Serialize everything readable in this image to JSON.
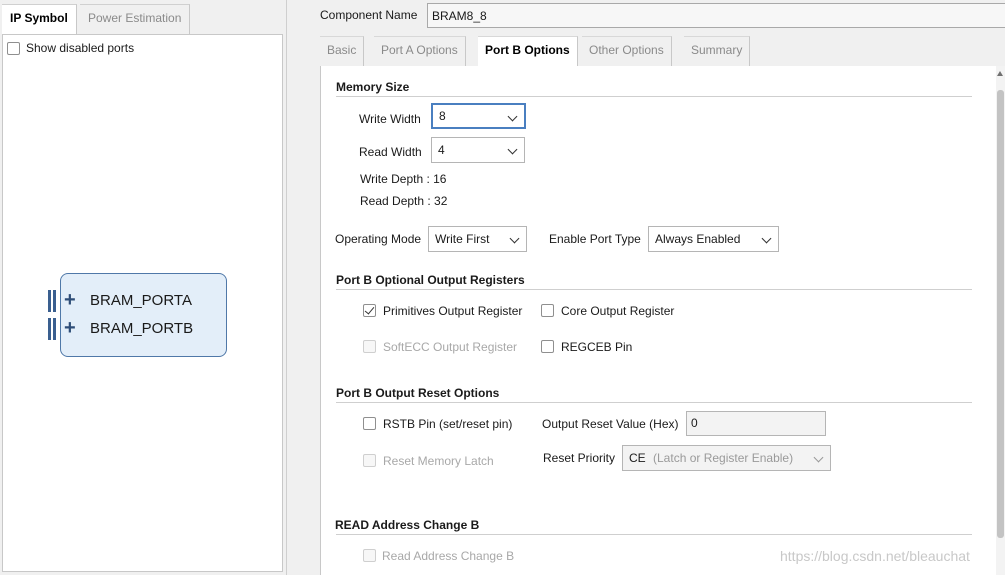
{
  "left_tabs": [
    "IP Symbol",
    "Power Estimation"
  ],
  "show_disabled_ports": "Show disabled ports",
  "ip_symbol": {
    "ports": [
      "BRAM_PORTA",
      "BRAM_PORTB"
    ]
  },
  "component_name": {
    "label": "Component Name",
    "value": "BRAM8_8"
  },
  "right_tabs": [
    "Basic",
    "Port A Options",
    "Port B Options",
    "Other Options",
    "Summary"
  ],
  "memory_size": {
    "title": "Memory Size",
    "write_width_label": "Write Width",
    "write_width_value": "8",
    "read_width_label": "Read Width",
    "read_width_value": "4",
    "write_depth": "Write Depth : 16",
    "read_depth": "Read Depth : 32"
  },
  "operating_mode": {
    "label": "Operating Mode",
    "value": "Write First"
  },
  "enable_port_type": {
    "label": "Enable Port Type",
    "value": "Always Enabled"
  },
  "optional_registers": {
    "title": "Port B Optional Output Registers",
    "primitives": "Primitives Output Register",
    "core": "Core Output Register",
    "softecc": "SoftECC Output Register",
    "regceb": "REGCEB Pin"
  },
  "reset_options": {
    "title": "Port B Output Reset Options",
    "rstb": "RSTB Pin (set/reset pin)",
    "reset_value_label": "Output Reset Value (Hex)",
    "reset_value": "0",
    "reset_memory_latch": "Reset Memory Latch",
    "reset_priority_label": "Reset Priority",
    "reset_priority_value": "CE",
    "reset_priority_hint": "(Latch or Register Enable)"
  },
  "read_address_change": {
    "title": "READ Address Change B",
    "checkbox": "Read Address Change B"
  },
  "watermark": "https://blog.csdn.net/bleauchat"
}
